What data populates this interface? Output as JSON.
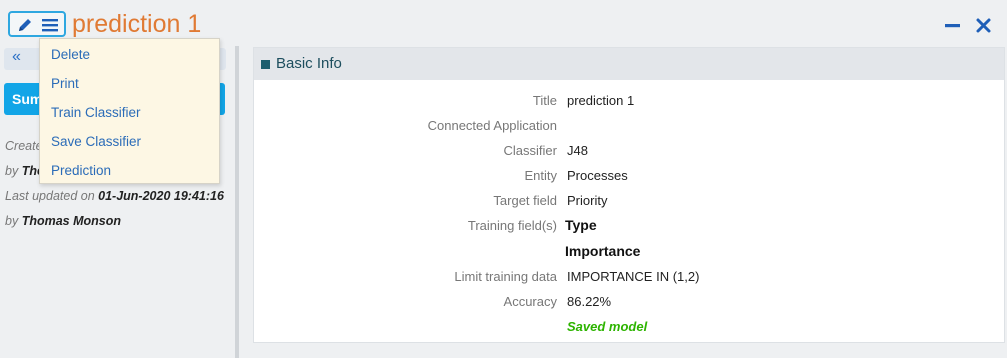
{
  "header": {
    "title": "prediction 1"
  },
  "menu": {
    "items": [
      "Delete",
      "Print",
      "Train Classifier",
      "Save Classifier",
      "Prediction"
    ]
  },
  "sidebar": {
    "collapse_glyph": "«",
    "summary_label": "Sum",
    "created_prefix": "Create",
    "created_by_prefix": "by ",
    "created_by": "The",
    "updated_prefix": "Last updated on ",
    "updated_on": "01-Jun-2020 19:41:16",
    "updated_by_prefix": "by ",
    "updated_by": "Thomas Monson"
  },
  "basic_info": {
    "heading": "Basic Info",
    "fields": [
      {
        "label": "Title",
        "value": "prediction 1"
      },
      {
        "label": "Connected Application",
        "value": ""
      },
      {
        "label": "Classifier",
        "value": "J48"
      },
      {
        "label": "Entity",
        "value": "Processes"
      },
      {
        "label": "Target field",
        "value": "Priority"
      },
      {
        "label": "Training field(s)",
        "value": "Type"
      },
      {
        "label": "",
        "value": "Importance"
      },
      {
        "label": "Limit training data",
        "value": "IMPORTANCE IN (1,2)"
      },
      {
        "label": "Accuracy",
        "value": "86.22%"
      }
    ],
    "saved_model": "Saved model"
  },
  "colors": {
    "accent": "#12a5e7",
    "title": "#e07a34",
    "link": "#2b6cb8",
    "saved": "#2db400"
  },
  "icons": [
    "pencil-icon",
    "hamburger-menu-icon",
    "minimize-icon",
    "close-icon",
    "double-chevron-left-icon",
    "square-bullet-icon"
  ]
}
